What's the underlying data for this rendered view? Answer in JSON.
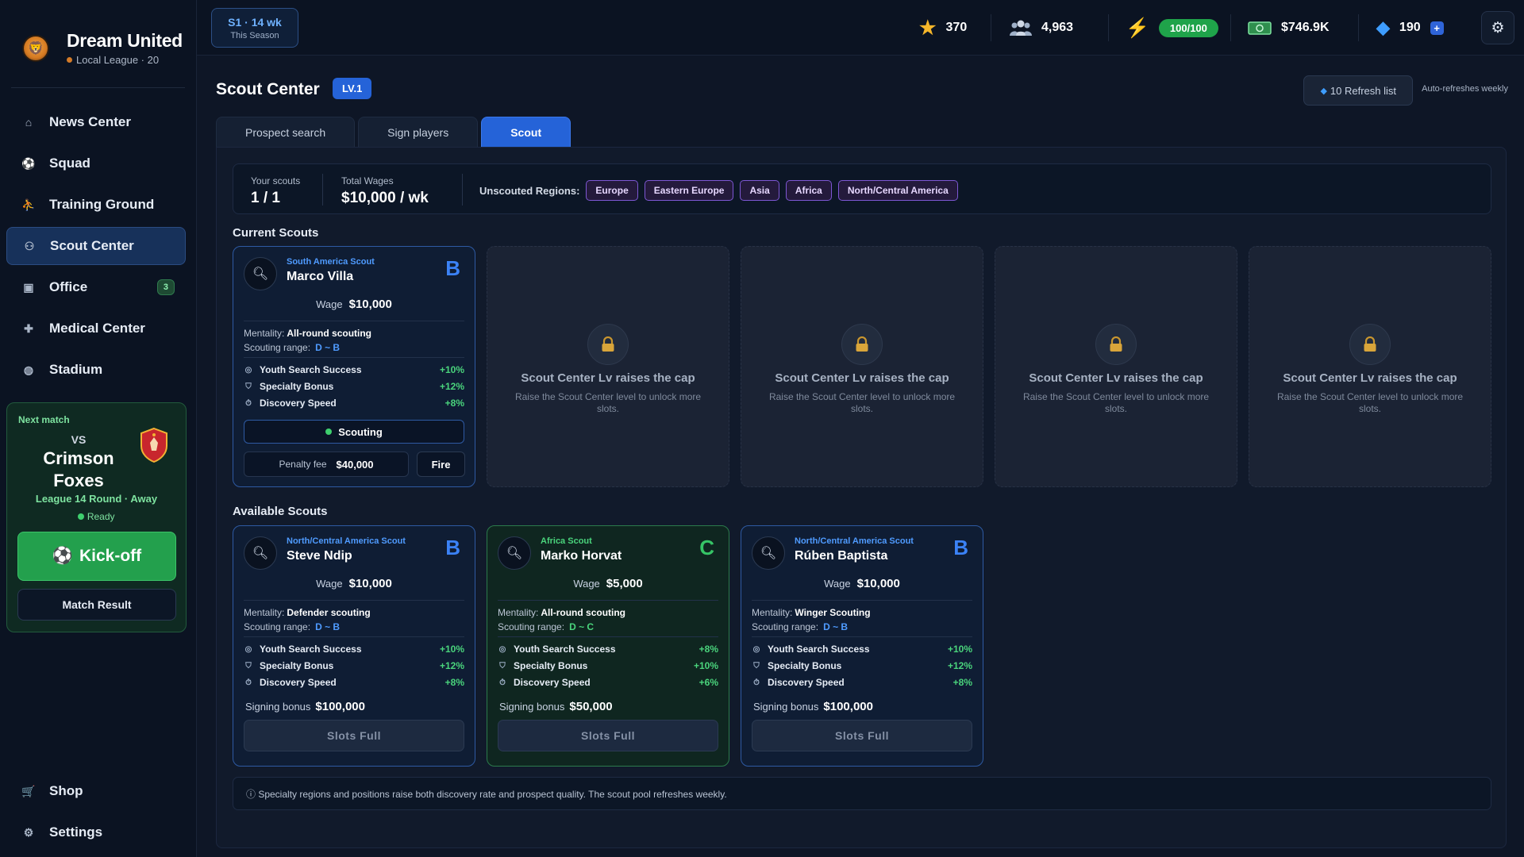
{
  "brand": {
    "name": "Dream United",
    "sub": "Local League · 20"
  },
  "nav": {
    "items": [
      {
        "label": "News Center",
        "icon": "home-icon"
      },
      {
        "label": "Squad",
        "icon": "squad-icon"
      },
      {
        "label": "Training Ground",
        "icon": "training-icon"
      },
      {
        "label": "Scout Center",
        "icon": "binoculars-icon"
      },
      {
        "label": "Office",
        "icon": "office-icon",
        "badge": "3"
      },
      {
        "label": "Medical Center",
        "icon": "medical-icon"
      },
      {
        "label": "Stadium",
        "icon": "stadium-icon"
      }
    ],
    "bottom": [
      {
        "label": "Shop",
        "icon": "cart-icon"
      },
      {
        "label": "Settings",
        "icon": "gear-icon"
      }
    ]
  },
  "next_match": {
    "label": "Next match",
    "vs": "VS",
    "team_line1": "Crimson",
    "team_line2": "Foxes",
    "round": "League 14 Round · Away",
    "ready": "Ready",
    "kickoff": "Kick-off",
    "result": "Match Result"
  },
  "topbar": {
    "season": "S1 · 14 wk",
    "season_sub": "This Season",
    "stars": "370",
    "fans": "4,963",
    "energy": "100/100",
    "money": "$746.9K",
    "gems": "190",
    "plus": "+"
  },
  "page": {
    "title": "Scout Center",
    "level": "LV.1",
    "refresh": "10 Refresh list",
    "auto_note": "Auto-refreshes weekly"
  },
  "tabs": [
    "Prospect search",
    "Sign players",
    "Scout"
  ],
  "summary": {
    "scouts_label": "Your scouts",
    "scouts_value": "1 / 1",
    "wages_label": "Total Wages",
    "wages_value": "$10,000 / wk",
    "regions_label": "Unscouted Regions:",
    "regions": [
      "Europe",
      "Eastern Europe",
      "Asia",
      "Africa",
      "North/Central America"
    ]
  },
  "labels": {
    "current": "Current Scouts",
    "available": "Available Scouts",
    "wage": "Wage",
    "mentality": "Mentality:",
    "range": "Scouting range:",
    "youth": "Youth Search Success",
    "specialty": "Specialty Bonus",
    "discovery": "Discovery Speed",
    "signing": "Signing bonus",
    "slots_full": "Slots Full",
    "scouting": "Scouting",
    "penalty": "Penalty fee",
    "fire": "Fire",
    "lock_title": "Scout Center Lv raises the cap",
    "lock_desc": "Raise the Scout Center level to unlock more slots."
  },
  "current_scout": {
    "region": "South America Scout",
    "name": "Marco Villa",
    "grade": "B",
    "wage": "$10,000",
    "mentality": "All-round scouting",
    "range": "D ~ B",
    "youth": "+10%",
    "specialty": "+12%",
    "discovery": "+8%",
    "penalty": "$40,000"
  },
  "available": [
    {
      "region": "North/Central America Scout",
      "name": "Steve Ndip",
      "grade": "B",
      "wage": "$10,000",
      "mentality": "Defender scouting",
      "range": "D ~ B",
      "youth": "+10%",
      "specialty": "+12%",
      "discovery": "+8%",
      "signing": "$100,000"
    },
    {
      "region": "Africa Scout",
      "name": "Marko Horvat",
      "grade": "C",
      "wage": "$5,000",
      "mentality": "All-round scouting",
      "range": "D ~ C",
      "youth": "+8%",
      "specialty": "+10%",
      "discovery": "+6%",
      "signing": "$50,000"
    },
    {
      "region": "North/Central America Scout",
      "name": "Rúben Baptista",
      "grade": "B",
      "wage": "$10,000",
      "mentality": "Winger Scouting",
      "range": "D ~ B",
      "youth": "+10%",
      "specialty": "+12%",
      "discovery": "+8%",
      "signing": "$100,000"
    }
  ],
  "footer": "ⓘ Specialty regions and positions raise both discovery rate and prospect quality. The scout pool refreshes weekly.",
  "colors": {
    "accent": "#2563d8",
    "positive": "#4ad47c",
    "region_chip": "#7d57d3"
  }
}
